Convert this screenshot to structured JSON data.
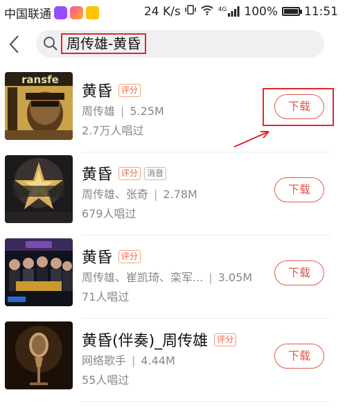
{
  "status_bar": {
    "carrier": "中国联通",
    "speed": "24 K/s",
    "network": "4G",
    "battery": "100%",
    "battery_level": 1.0,
    "time": "11:51",
    "icons": [
      "purple-app-icon",
      "pink-app-icon",
      "yellow-app-icon",
      "vibrate-icon",
      "wifi-icon",
      "signal-icon",
      "battery-icon"
    ]
  },
  "header": {
    "back_icon": "chevron-left-icon",
    "search_icon": "search-icon",
    "query": "周传雄-黄昏"
  },
  "songs": [
    {
      "title": "黄昏",
      "tags": [
        "评分"
      ],
      "artist": "周传雄",
      "size": "5.25M",
      "plays": "2.7万人唱过",
      "download_label": "下载",
      "cover": "transfer-album-cover"
    },
    {
      "title": "黄昏",
      "tags": [
        "评分",
        "消音"
      ],
      "artist": "周传雄、张奇",
      "size": "2.78M",
      "plays": "679人唱过",
      "download_label": "下载",
      "cover": "star-show-cover"
    },
    {
      "title": "黄昏",
      "tags": [
        "评分"
      ],
      "artist": "周传雄、崔凯琦、栾军...",
      "size": "3.05M",
      "plays": "71人唱过",
      "download_label": "下载",
      "cover": "group-show-cover"
    },
    {
      "title": "黄昏(伴奏)_周传雄",
      "tags": [
        "评分"
      ],
      "artist": "网络歌手",
      "size": "4.44M",
      "plays": "55人唱过",
      "download_label": "下载",
      "cover": "microphone-cover"
    }
  ],
  "colors": {
    "accent": "#e05a4a",
    "annotation": "#e2262a",
    "tag": "#e8643c"
  }
}
